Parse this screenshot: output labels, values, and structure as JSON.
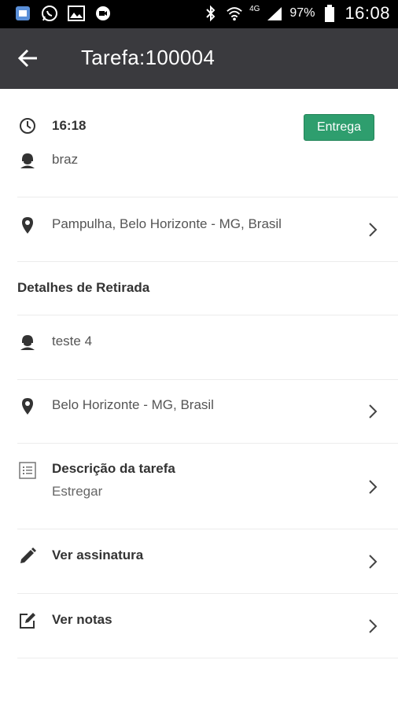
{
  "status_bar": {
    "network": "4G",
    "battery": "97%",
    "time": "16:08"
  },
  "app_bar": {
    "title": "Tarefa:100004"
  },
  "task": {
    "time": "16:18",
    "type_badge": "Entrega",
    "customer": "braz",
    "address": "Pampulha, Belo Horizonte - MG, Brasil"
  },
  "pickup": {
    "section_title": "Detalhes de Retirada",
    "contact": "teste 4",
    "address": "Belo Horizonte - MG, Brasil"
  },
  "description": {
    "label": "Descrição da tarefa",
    "value": "Estregar"
  },
  "actions": {
    "signature": "Ver assinatura",
    "notes": "Ver notas"
  },
  "colors": {
    "app_bar": "#3a3a3e",
    "badge": "#2e9e6e",
    "status_bar": "#000000"
  }
}
